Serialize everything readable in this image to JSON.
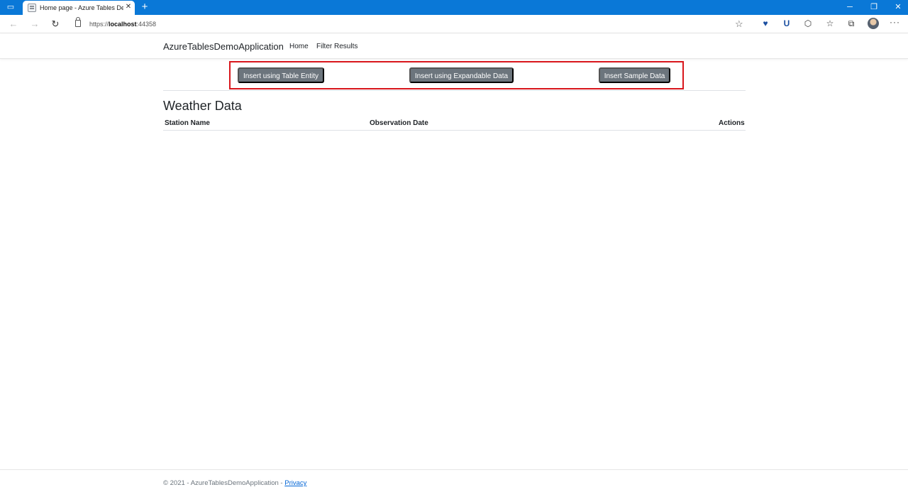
{
  "browser": {
    "tab_title": "Home page - Azure Tables Demo",
    "url_scheme": "https://",
    "url_host": "localhost",
    "url_port": ":44358",
    "tabbar_color": "#0a78d7"
  },
  "app": {
    "brand": "AzureTablesDemoApplication",
    "nav": [
      "Home",
      "Filter Results"
    ],
    "buttons": {
      "table_entity": "Insert using Table Entity",
      "expandable": "Insert using Expandable Data",
      "sample": "Insert Sample Data"
    },
    "heading": "Weather Data",
    "columns": {
      "station": "Station Name",
      "date": "Observation Date",
      "actions": "Actions"
    },
    "footer": {
      "text": "© 2021 - AzureTablesDemoApplication - ",
      "privacy": "Privacy"
    }
  },
  "colors": {
    "button": "#6c757d",
    "highlight_border": "#d9161c",
    "link": "#0366d6"
  }
}
